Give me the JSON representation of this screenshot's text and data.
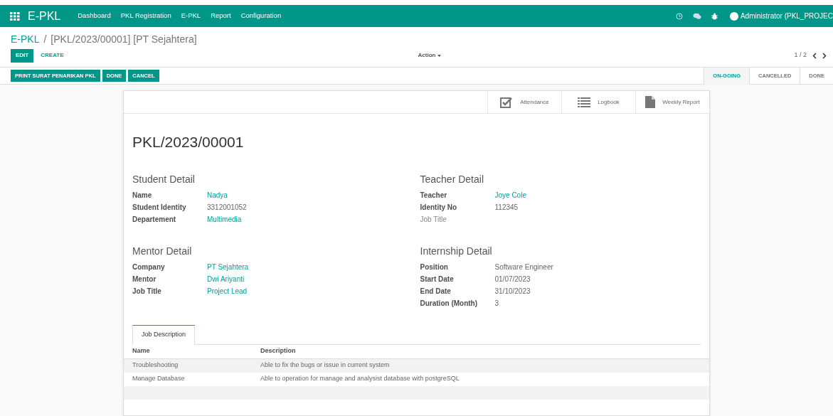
{
  "navbar": {
    "app_name": "E-PKL",
    "menu": [
      "Dashboard",
      "PKL Registration",
      "E-PKL",
      "Report",
      "Configuration"
    ],
    "user": "Administrator (PKL_PROJEC"
  },
  "breadcrumb": {
    "parent": "E-PKL",
    "separator": "/",
    "current": "[PKL/2023/00001] [PT Sejahtera]"
  },
  "control_buttons": [
    {
      "label": "EDIT",
      "kind": "primary"
    },
    {
      "label": "CREATE",
      "kind": "link"
    }
  ],
  "action_menu": "Action",
  "pager": "1 / 2",
  "header_buttons": [
    "PRINT SURAT PENARIKAN PKL",
    "DONE",
    "CANCEL"
  ],
  "stages": [
    {
      "label": "ON-GOING",
      "selected": true
    },
    {
      "label": "CANCELLED",
      "selected": false
    },
    {
      "label": "DONE",
      "selected": false
    }
  ],
  "smart_buttons": [
    {
      "label": "Attendance",
      "kind": "check"
    },
    {
      "label": "Logbook",
      "kind": "list"
    },
    {
      "label": "Weekly Report",
      "kind": "file"
    }
  ],
  "record_title": "PKL/2023/00001",
  "groups": [
    {
      "title": "Student Detail",
      "fields": [
        {
          "label": "Name",
          "value": "Nadya",
          "kind": "link"
        },
        {
          "label": "Student Identity",
          "value": "3312001052",
          "kind": "text"
        },
        {
          "label": "Departement",
          "value": "Multimedia",
          "kind": "link"
        }
      ]
    },
    {
      "title": "Teacher Detail",
      "fields": [
        {
          "label": "Teacher",
          "value": "Joye Cole",
          "kind": "link"
        },
        {
          "label": "Identity No",
          "value": "112345",
          "kind": "text"
        },
        {
          "label": "Job Title",
          "kind": "empty"
        }
      ]
    },
    {
      "title": "Mentor Detail",
      "fields": [
        {
          "label": "Company",
          "value": "PT Sejahtera",
          "kind": "link"
        },
        {
          "label": "Mentor",
          "value": "Dwi Ariyanti",
          "kind": "link"
        },
        {
          "label": "Job Title",
          "value": "Project Lead",
          "kind": "link"
        }
      ]
    },
    {
      "title": "Internship Detail",
      "fields": [
        {
          "label": "Position",
          "value": "Software Engineer",
          "kind": "text"
        },
        {
          "label": "Start Date",
          "value": "01/07/2023",
          "kind": "text"
        },
        {
          "label": "End Date",
          "value": "31/10/2023",
          "kind": "text"
        },
        {
          "label": "Duration (Month)",
          "value": "3",
          "kind": "text"
        }
      ]
    }
  ],
  "notebook": {
    "tabs": [
      {
        "label": "Job Description",
        "selected": true
      }
    ],
    "columns": [
      "Name",
      "Description"
    ],
    "rows": [
      [
        "Troubleshooting",
        "Able to fix the bugs or issue in current system"
      ],
      [
        "Manage Database",
        "Able to operation for manage and analysist database with postgreSQL"
      ]
    ]
  }
}
